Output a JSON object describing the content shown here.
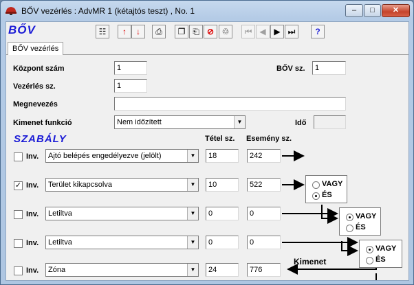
{
  "window": {
    "title": "BŐV vezérlés : AdvMR 1 (kétajtós teszt) , No. 1",
    "minimize_glyph": "–",
    "maximize_glyph": "□",
    "close_glyph": "✕"
  },
  "toolbar": {
    "logo": "BŐV",
    "buttons": [
      {
        "glyph": "☷"
      },
      {
        "glyph": "↑"
      },
      {
        "glyph": "↓"
      },
      {
        "glyph": "⎙"
      },
      {
        "glyph": "❐"
      },
      {
        "glyph": "⎗"
      },
      {
        "glyph": "⊘"
      },
      {
        "glyph": "♲"
      },
      {
        "glyph": "⏮"
      },
      {
        "glyph": "◀"
      },
      {
        "glyph": "▶"
      },
      {
        "glyph": "⏭"
      },
      {
        "glyph": "?"
      }
    ]
  },
  "tabs": [
    {
      "label": "BŐV vezérlés"
    }
  ],
  "form": {
    "kozpont_label": "Központ szám",
    "kozpont_value": "1",
    "bov_label": "BŐV sz.",
    "bov_value": "1",
    "vezerles_label": "Vezérlés sz.",
    "vezerles_value": "1",
    "megnevezes_label": "Megnevezés",
    "megnevezes_value": "",
    "kimenet_label": "Kimenet funkció",
    "kimenet_value": "Nem időzített",
    "ido_label": "Idő",
    "ido_value": ""
  },
  "rules": {
    "heading": "SZABÁLY",
    "tetel_header": "Tétel sz.",
    "esemeny_header": "Esemény sz.",
    "inv_label": "Inv.",
    "rows": [
      {
        "checked": false,
        "event": "Ajtó belépés engedélyezve (jelölt)",
        "tetel": "18",
        "esemeny": "242"
      },
      {
        "checked": true,
        "event": "Terület kikapcsolva",
        "tetel": "10",
        "esemeny": "522"
      },
      {
        "checked": false,
        "event": "Letiltva",
        "tetel": "0",
        "esemeny": "0"
      },
      {
        "checked": false,
        "event": "Letiltva",
        "tetel": "0",
        "esemeny": "0"
      },
      {
        "checked": false,
        "event": "Zóna",
        "tetel": "24",
        "esemeny": "776"
      }
    ],
    "logic": [
      {
        "vagy": "VAGY",
        "es": "ÉS",
        "selected": "ÉS"
      },
      {
        "vagy": "VAGY",
        "es": "ÉS",
        "selected": "VAGY"
      },
      {
        "vagy": "VAGY",
        "es": "ÉS",
        "selected": "VAGY"
      }
    ],
    "kimenet_output_label": "Kimenet"
  }
}
